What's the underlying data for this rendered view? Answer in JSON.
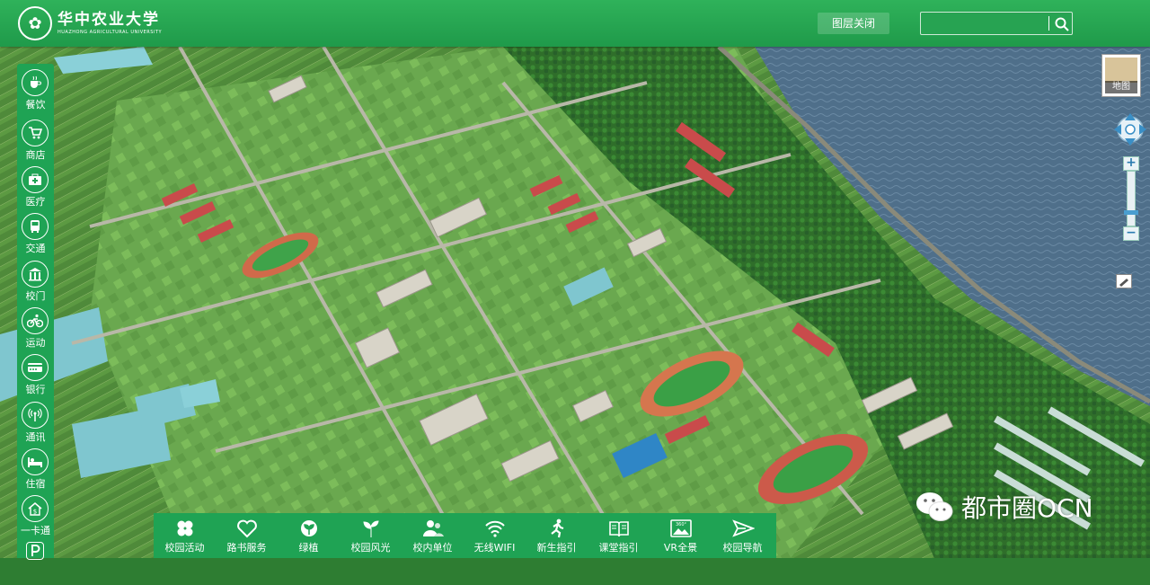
{
  "header": {
    "logo_cn": "华中农业大学",
    "logo_en": "HUAZHONG AGRICULTURAL UNIVERSITY",
    "layer_button": "图层关闭",
    "search_placeholder": ""
  },
  "sidebar": {
    "items": [
      {
        "label": "餐饮",
        "icon": "cup-icon"
      },
      {
        "label": "商店",
        "icon": "cart-icon"
      },
      {
        "label": "医疗",
        "icon": "medical-kit-icon"
      },
      {
        "label": "交通",
        "icon": "bus-icon"
      },
      {
        "label": "校门",
        "icon": "gate-icon"
      },
      {
        "label": "运动",
        "icon": "cycling-icon"
      },
      {
        "label": "银行",
        "icon": "bank-card-icon"
      },
      {
        "label": "通讯",
        "icon": "antenna-icon"
      },
      {
        "label": "住宿",
        "icon": "bed-icon"
      },
      {
        "label": "一卡通",
        "icon": "house-money-icon"
      },
      {
        "label": "",
        "icon": "parking-icon"
      }
    ]
  },
  "map_controls": {
    "map_toggle_label": "地图"
  },
  "toolbar": {
    "items": [
      {
        "label": "校园活动",
        "icon": "clover-icon"
      },
      {
        "label": "路书服务",
        "icon": "heart-icon"
      },
      {
        "label": "绿植",
        "icon": "plant-icon"
      },
      {
        "label": "校园风光",
        "icon": "sprout-icon"
      },
      {
        "label": "校内单位",
        "icon": "people-icon"
      },
      {
        "label": "无线WIFI",
        "icon": "wifi-icon"
      },
      {
        "label": "新生指引",
        "icon": "running-icon"
      },
      {
        "label": "课堂指引",
        "icon": "book-icon"
      },
      {
        "label": "VR全景",
        "icon": "panorama-icon"
      },
      {
        "label": "校园导航",
        "icon": "send-icon"
      }
    ]
  },
  "watermark": {
    "text": "都市圈OCN"
  },
  "colors": {
    "header_green": "#1f9a4a",
    "sidebar_green": "#1fa354",
    "lake_blue": "#4d6c85"
  }
}
